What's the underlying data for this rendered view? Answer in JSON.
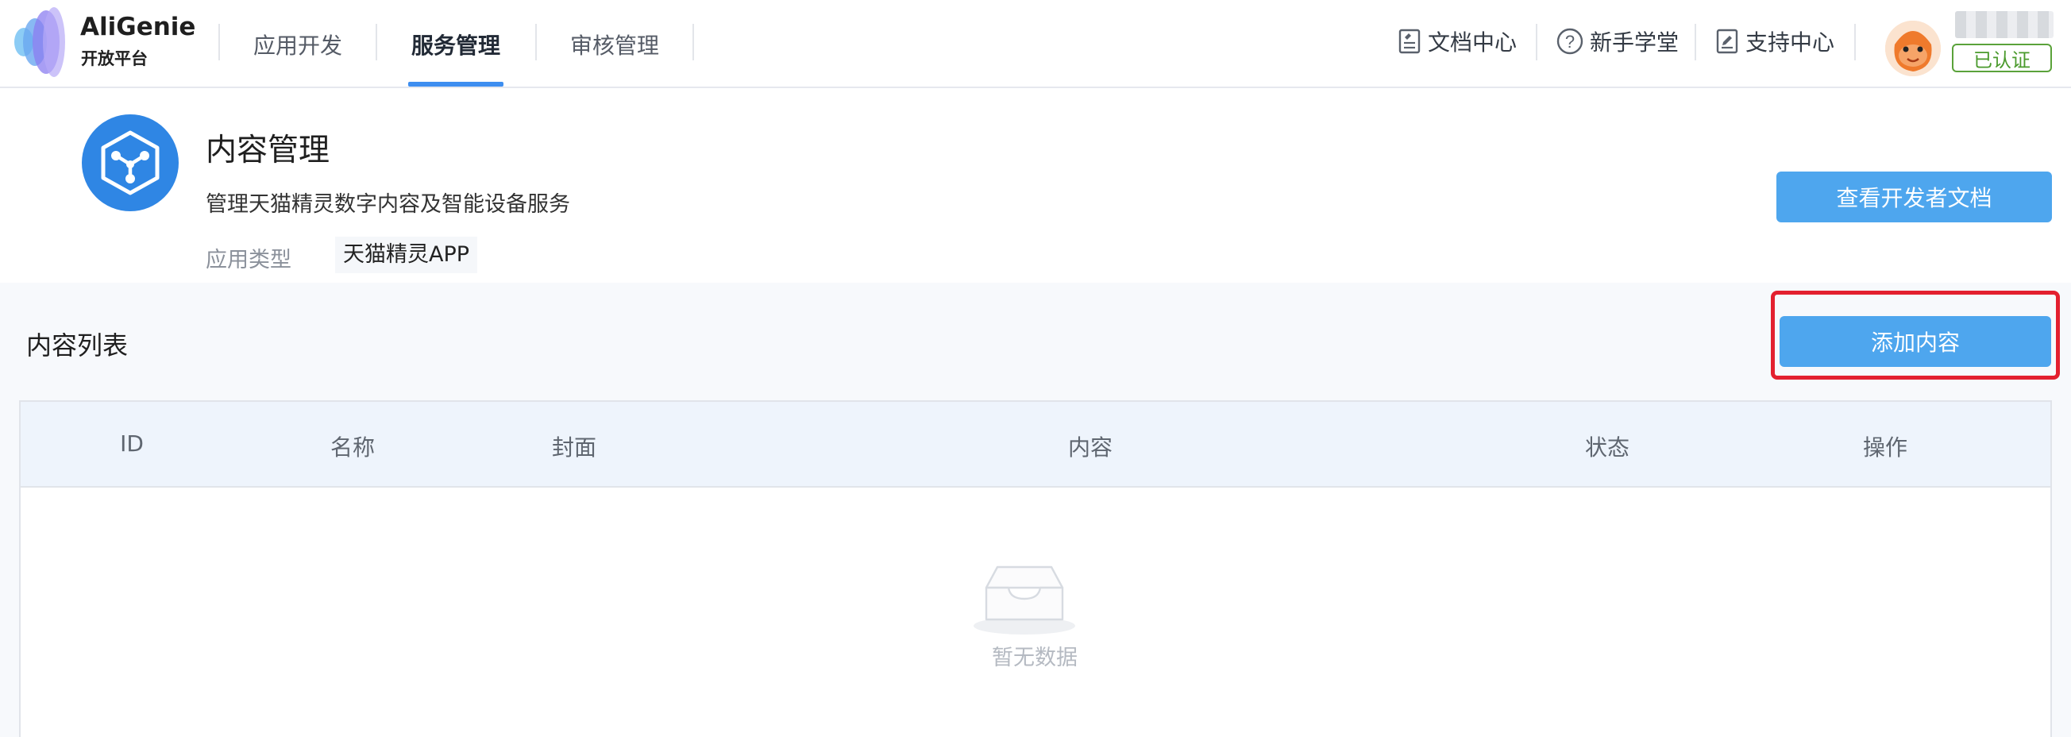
{
  "brand": {
    "name": "AliGenie",
    "subtitle": "开放平台"
  },
  "nav": [
    {
      "label": "应用开发",
      "active": false
    },
    {
      "label": "服务管理",
      "active": true
    },
    {
      "label": "审核管理",
      "active": false
    }
  ],
  "header_links": [
    {
      "label": "文档中心",
      "icon": "document-icon"
    },
    {
      "label": "新手学堂",
      "icon": "question-circle-icon"
    },
    {
      "label": "支持中心",
      "icon": "edit-document-icon"
    }
  ],
  "user": {
    "verified_label": "已认证"
  },
  "app": {
    "title": "内容管理",
    "description": "管理天猫精灵数字内容及智能设备服务",
    "type_label": "应用类型",
    "type_value": "天猫精灵APP",
    "docs_button": "查看开发者文档",
    "icon": "cube-node-icon"
  },
  "content_list": {
    "title": "内容列表",
    "add_button": "添加内容",
    "columns": [
      "ID",
      "名称",
      "封面",
      "内容",
      "状态",
      "操作"
    ],
    "empty_text": "暂无数据"
  },
  "colors": {
    "primary_button": "#4ea6ee",
    "nav_active_underline": "#3d8ef0",
    "highlight_box": "#e3202f",
    "verified": "#4a9a2c"
  }
}
